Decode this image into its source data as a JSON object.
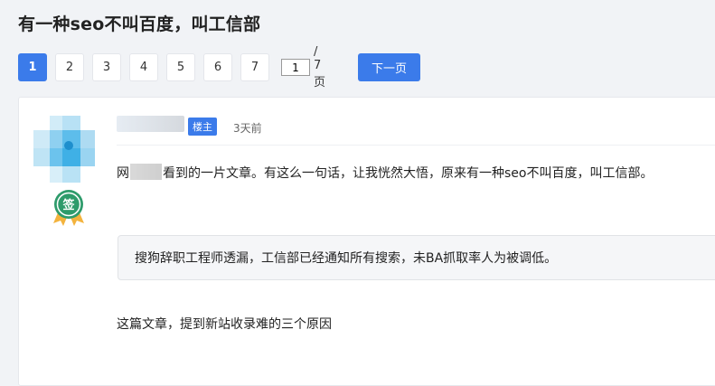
{
  "thread": {
    "title": "有一种seo不叫百度，叫工信部"
  },
  "pagination": {
    "pages": [
      "1",
      "2",
      "3",
      "4",
      "5",
      "6",
      "7"
    ],
    "current_page": "1",
    "page_input_value": "1",
    "total_label": "/ 7 页",
    "next_label": "下一页"
  },
  "post": {
    "owner_tag": "楼主",
    "time": "3天前",
    "badge_label": "签",
    "p1_prefix": "网",
    "p1_suffix": "看到的一片文章。有这么一句话，让我恍然大悟，原来有一种seo不叫百度，叫工信部。",
    "quote": "搜狗辞职工程师透漏，工信部已经通知所有搜索，未BA抓取率人为被调低。",
    "p2": "这篇文章，提到新站收录难的三个原因"
  },
  "colors": {
    "accent": "#3b7bea",
    "badge_green": "#2e9b6b",
    "badge_gold": "#f3b33d"
  }
}
